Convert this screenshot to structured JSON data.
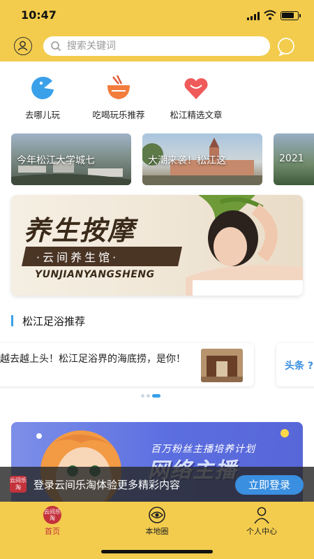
{
  "status_bar": {
    "time": "10:47"
  },
  "header": {
    "search_placeholder": "搜索关键词",
    "icons": [
      "user-icon",
      "search-icon",
      "chat-icon"
    ]
  },
  "categories": [
    {
      "label": "去哪儿玩",
      "icon": "fish-icon"
    },
    {
      "label": "吃喝玩乐推荐",
      "icon": "bowl-icon"
    },
    {
      "label": "松江精选文章",
      "icon": "heart-icon"
    }
  ],
  "news_carousel": [
    {
      "caption": "今年松江大学城七"
    },
    {
      "caption": "大潮来袭！松江这"
    },
    {
      "caption": "2021"
    }
  ],
  "banner": {
    "title": "养生按摩",
    "subtitle": "·云间养生馆·",
    "english": "YUNJIANYANGSHENG"
  },
  "section": {
    "title": "松江足浴推荐"
  },
  "recommend": {
    "text": "越去越上头！松江足浴界的海底捞，是你！",
    "next_card": "头条 ?"
  },
  "promo": {
    "caption": "百万粉丝主播培养计划",
    "headline": "网络主播"
  },
  "login_bar": {
    "logo_text": "云间乐淘",
    "message": "登录云间乐淘体验更多精彩内容",
    "button": "立即登录"
  },
  "tabbar": {
    "items": [
      {
        "label": "首页",
        "icon_text": "云间乐淘",
        "active": true
      },
      {
        "label": "本地圈",
        "active": false
      },
      {
        "label": "个人中心",
        "active": false
      }
    ]
  },
  "colors": {
    "brand_yellow": "#f3cc4d",
    "accent_blue": "#3a8fe0",
    "brand_red": "#c4323c"
  }
}
